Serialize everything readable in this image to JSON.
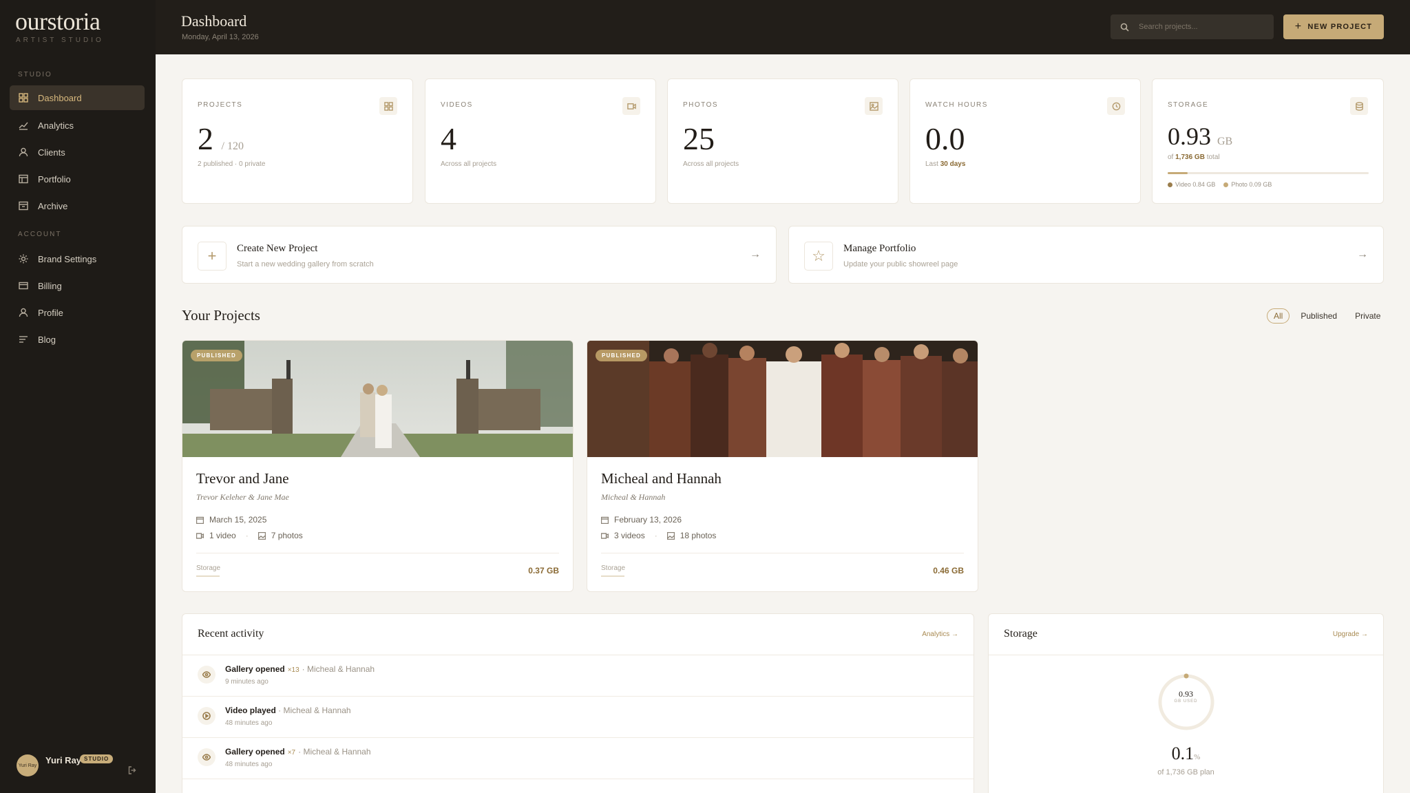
{
  "app": {
    "logo": "ourstoria",
    "logo_sub": "ARTIST STUDIO"
  },
  "sidebar": {
    "section_studio": "STUDIO",
    "section_account": "ACCOUNT",
    "items": [
      {
        "label": "Dashboard",
        "icon": "grid-icon",
        "active": true
      },
      {
        "label": "Analytics",
        "icon": "chart-line-icon"
      },
      {
        "label": "Clients",
        "icon": "user-icon"
      },
      {
        "label": "Portfolio",
        "icon": "portfolio-icon"
      },
      {
        "label": "Archive",
        "icon": "archive-icon"
      },
      {
        "label": "Brand Settings",
        "icon": "sun-icon"
      },
      {
        "label": "Billing",
        "icon": "card-icon"
      },
      {
        "label": "Profile",
        "icon": "user-icon"
      },
      {
        "label": "Blog",
        "icon": "lines-icon"
      }
    ],
    "user": {
      "name": "Yuri Ray",
      "avatar_text": "Yuri Ray",
      "badge": "STUDIO"
    }
  },
  "header": {
    "title": "Dashboard",
    "date": "Monday, April 13, 2026",
    "search_placeholder": "Search projects...",
    "new_project_label": "NEW PROJECT"
  },
  "stats": {
    "projects": {
      "label": "PROJECTS",
      "value": "2",
      "suffix": "/ 120",
      "sub": "2 published · 0 private"
    },
    "videos": {
      "label": "VIDEOS",
      "value": "4",
      "sub": "Across all projects"
    },
    "photos": {
      "label": "PHOTOS",
      "value": "25",
      "sub": "Across all projects"
    },
    "watch_hours": {
      "label": "WATCH HOURS",
      "value": "0.0",
      "sub_prefix": "Last",
      "sub_bold": "30 days"
    },
    "storage": {
      "label": "STORAGE",
      "value": "0.93",
      "unit": "GB",
      "sub_prefix": "of",
      "sub_bold": "1,736 GB",
      "sub_suffix": "total",
      "used_fraction": 0.1,
      "legend_video": "Video 0.84 GB",
      "legend_photo": "Photo 0.09 GB"
    }
  },
  "actions": [
    {
      "title": "Create New Project",
      "subtitle": "Start a new wedding gallery from scratch",
      "icon": "plus-icon"
    },
    {
      "title": "Manage Portfolio",
      "subtitle": "Update your public showreel page",
      "icon": "star-icon"
    }
  ],
  "projects": {
    "title": "Your Projects",
    "filters": [
      "All",
      "Published",
      "Private"
    ],
    "active_filter": "All",
    "items": [
      {
        "badge": "PUBLISHED",
        "title": "Trevor and Jane",
        "subtitle": "Trevor Keleher & Jane Mae",
        "date": "March 15, 2025",
        "videos": "1 video",
        "photos": "7 photos",
        "storage_label": "Storage",
        "storage": "0.37 GB"
      },
      {
        "badge": "PUBLISHED",
        "title": "Micheal and Hannah",
        "subtitle": "Micheal & Hannah",
        "date": "February 13, 2026",
        "videos": "3 videos",
        "photos": "18 photos",
        "storage_label": "Storage",
        "storage": "0.46 GB"
      }
    ]
  },
  "activity": {
    "title": "Recent activity",
    "link": "Analytics →",
    "rows": [
      {
        "action": "Gallery opened",
        "count": "×13",
        "target": "Micheal & Hannah",
        "time": "9 minutes ago",
        "icon": "eye-icon"
      },
      {
        "action": "Video played",
        "count": "",
        "target": "Micheal & Hannah",
        "time": "48 minutes ago",
        "icon": "play-icon"
      },
      {
        "action": "Gallery opened",
        "count": "×7",
        "target": "Micheal & Hannah",
        "time": "48 minutes ago",
        "icon": "eye-icon"
      }
    ]
  },
  "storage_panel": {
    "title": "Storage",
    "link": "Upgrade →",
    "ring_value": "0.93",
    "ring_label": "GB USED",
    "percent": "0.1",
    "percent_unit": "%",
    "plan": "of 1,736 GB plan"
  },
  "colors": {
    "accent": "#c6aa77",
    "sidebar_bg": "#1e1b17",
    "header_bg": "#221e19",
    "page_bg": "#f6f4f0"
  }
}
